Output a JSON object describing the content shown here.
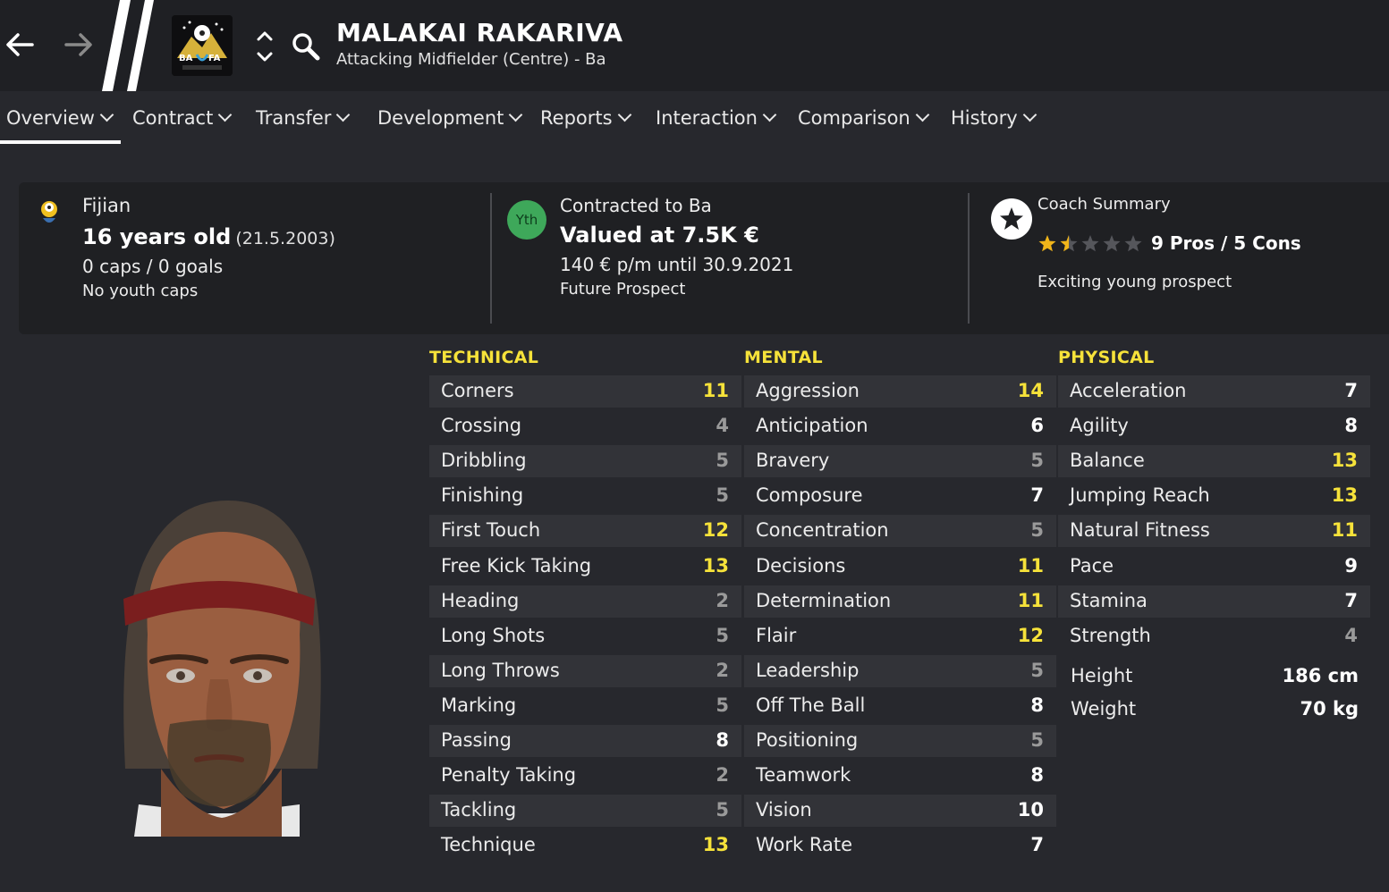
{
  "header": {
    "player_name": "MALAKAI RAKARIVA",
    "position_club": "Attacking Midfielder (Centre) - Ba",
    "club_badge_text": "BA FA"
  },
  "tabs": [
    {
      "label": "Overview"
    },
    {
      "label": "Contract"
    },
    {
      "label": "Transfer"
    },
    {
      "label": "Development"
    },
    {
      "label": "Reports"
    },
    {
      "label": "Interaction"
    },
    {
      "label": "Comparison"
    },
    {
      "label": "History"
    }
  ],
  "info": {
    "nationality": "Fijian",
    "age": "16 years old",
    "dob": "(21.5.2003)",
    "caps_goals": "0 caps / 0 goals",
    "youth_caps": "No youth caps",
    "yth_badge": "Yth",
    "contracted_to": "Contracted to Ba",
    "valued_at": "Valued at 7.5K €",
    "wage": "140 € p/m until 30.9.2021",
    "prospect": "Future Prospect",
    "coach_title": "Coach Summary",
    "pros_cons": "9 Pros / 5 Cons",
    "coach_stars": 1.5,
    "coach_stars_max": 5,
    "coach_note": "Exciting young prospect"
  },
  "attributes": {
    "technical_title": "TECHNICAL",
    "mental_title": "MENTAL",
    "physical_title": "PHYSICAL",
    "technical": [
      {
        "name": "Corners",
        "value": "11"
      },
      {
        "name": "Crossing",
        "value": "4"
      },
      {
        "name": "Dribbling",
        "value": "5"
      },
      {
        "name": "Finishing",
        "value": "5"
      },
      {
        "name": "First Touch",
        "value": "12"
      },
      {
        "name": "Free Kick Taking",
        "value": "13"
      },
      {
        "name": "Heading",
        "value": "2"
      },
      {
        "name": "Long Shots",
        "value": "5"
      },
      {
        "name": "Long Throws",
        "value": "2"
      },
      {
        "name": "Marking",
        "value": "5"
      },
      {
        "name": "Passing",
        "value": "8"
      },
      {
        "name": "Penalty Taking",
        "value": "2"
      },
      {
        "name": "Tackling",
        "value": "5"
      },
      {
        "name": "Technique",
        "value": "13"
      }
    ],
    "mental": [
      {
        "name": "Aggression",
        "value": "14"
      },
      {
        "name": "Anticipation",
        "value": "6"
      },
      {
        "name": "Bravery",
        "value": "5"
      },
      {
        "name": "Composure",
        "value": "7"
      },
      {
        "name": "Concentration",
        "value": "5"
      },
      {
        "name": "Decisions",
        "value": "11"
      },
      {
        "name": "Determination",
        "value": "11"
      },
      {
        "name": "Flair",
        "value": "12"
      },
      {
        "name": "Leadership",
        "value": "5"
      },
      {
        "name": "Off The Ball",
        "value": "8"
      },
      {
        "name": "Positioning",
        "value": "5"
      },
      {
        "name": "Teamwork",
        "value": "8"
      },
      {
        "name": "Vision",
        "value": "10"
      },
      {
        "name": "Work Rate",
        "value": "7"
      }
    ],
    "physical": [
      {
        "name": "Acceleration",
        "value": "7"
      },
      {
        "name": "Agility",
        "value": "8"
      },
      {
        "name": "Balance",
        "value": "13"
      },
      {
        "name": "Jumping Reach",
        "value": "13"
      },
      {
        "name": "Natural Fitness",
        "value": "11"
      },
      {
        "name": "Pace",
        "value": "9"
      },
      {
        "name": "Stamina",
        "value": "7"
      },
      {
        "name": "Strength",
        "value": "4"
      }
    ],
    "height_label": "Height",
    "height_value": "186 cm",
    "weight_label": "Weight",
    "weight_value": "70 kg"
  },
  "colors": {
    "accent_yellow": "#f6e23a",
    "background": "#27282d",
    "header_bg": "#1f2024",
    "yth_green": "#3ea85a"
  }
}
